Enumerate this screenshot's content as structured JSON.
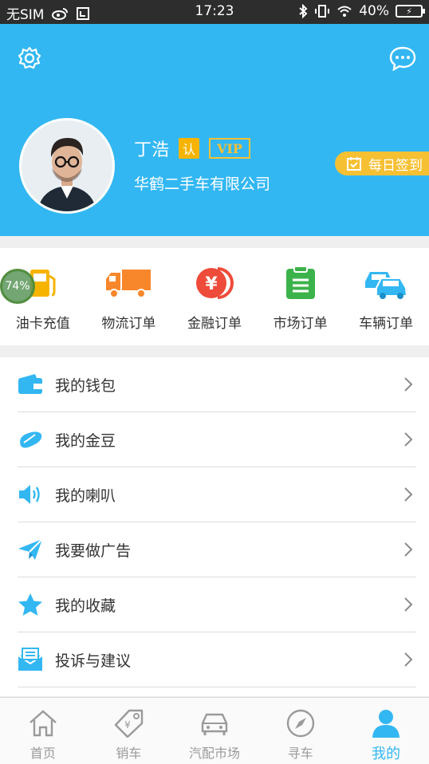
{
  "statusbar": {
    "carrier": "无SIM",
    "time": "17:23",
    "battery": "40%"
  },
  "profile": {
    "name": "丁浩",
    "verified_badge": "认",
    "vip_badge": "VIP",
    "company": "华鹤二手车有限公司",
    "checkin_label": "每日签到"
  },
  "quick_actions": [
    {
      "label": "油卡充值",
      "icon": "fuel-card-icon"
    },
    {
      "label": "物流订单",
      "icon": "truck-icon"
    },
    {
      "label": "金融订单",
      "icon": "yen-coin-icon"
    },
    {
      "label": "市场订单",
      "icon": "clipboard-icon"
    },
    {
      "label": "车辆订单",
      "icon": "cars-icon"
    }
  ],
  "floating_bubble": "74%",
  "menu": [
    {
      "label": "我的钱包",
      "icon": "wallet-icon"
    },
    {
      "label": "我的金豆",
      "icon": "bean-icon"
    },
    {
      "label": "我的喇叭",
      "icon": "speaker-icon"
    },
    {
      "label": "我要做广告",
      "icon": "paper-plane-icon"
    },
    {
      "label": "我的收藏",
      "icon": "star-icon"
    },
    {
      "label": "投诉与建议",
      "icon": "mail-icon"
    }
  ],
  "tabs": [
    {
      "label": "首页",
      "icon": "home-icon",
      "active": false
    },
    {
      "label": "销车",
      "icon": "price-tag-icon",
      "active": false
    },
    {
      "label": "汽配市场",
      "icon": "car-icon",
      "active": false
    },
    {
      "label": "寻车",
      "icon": "compass-icon",
      "active": false
    },
    {
      "label": "我的",
      "icon": "user-icon",
      "active": true
    }
  ],
  "colors": {
    "primary": "#33b7f2",
    "gold": "#f6c033",
    "text": "#333333",
    "tab_inactive": "#9a9a9a"
  }
}
